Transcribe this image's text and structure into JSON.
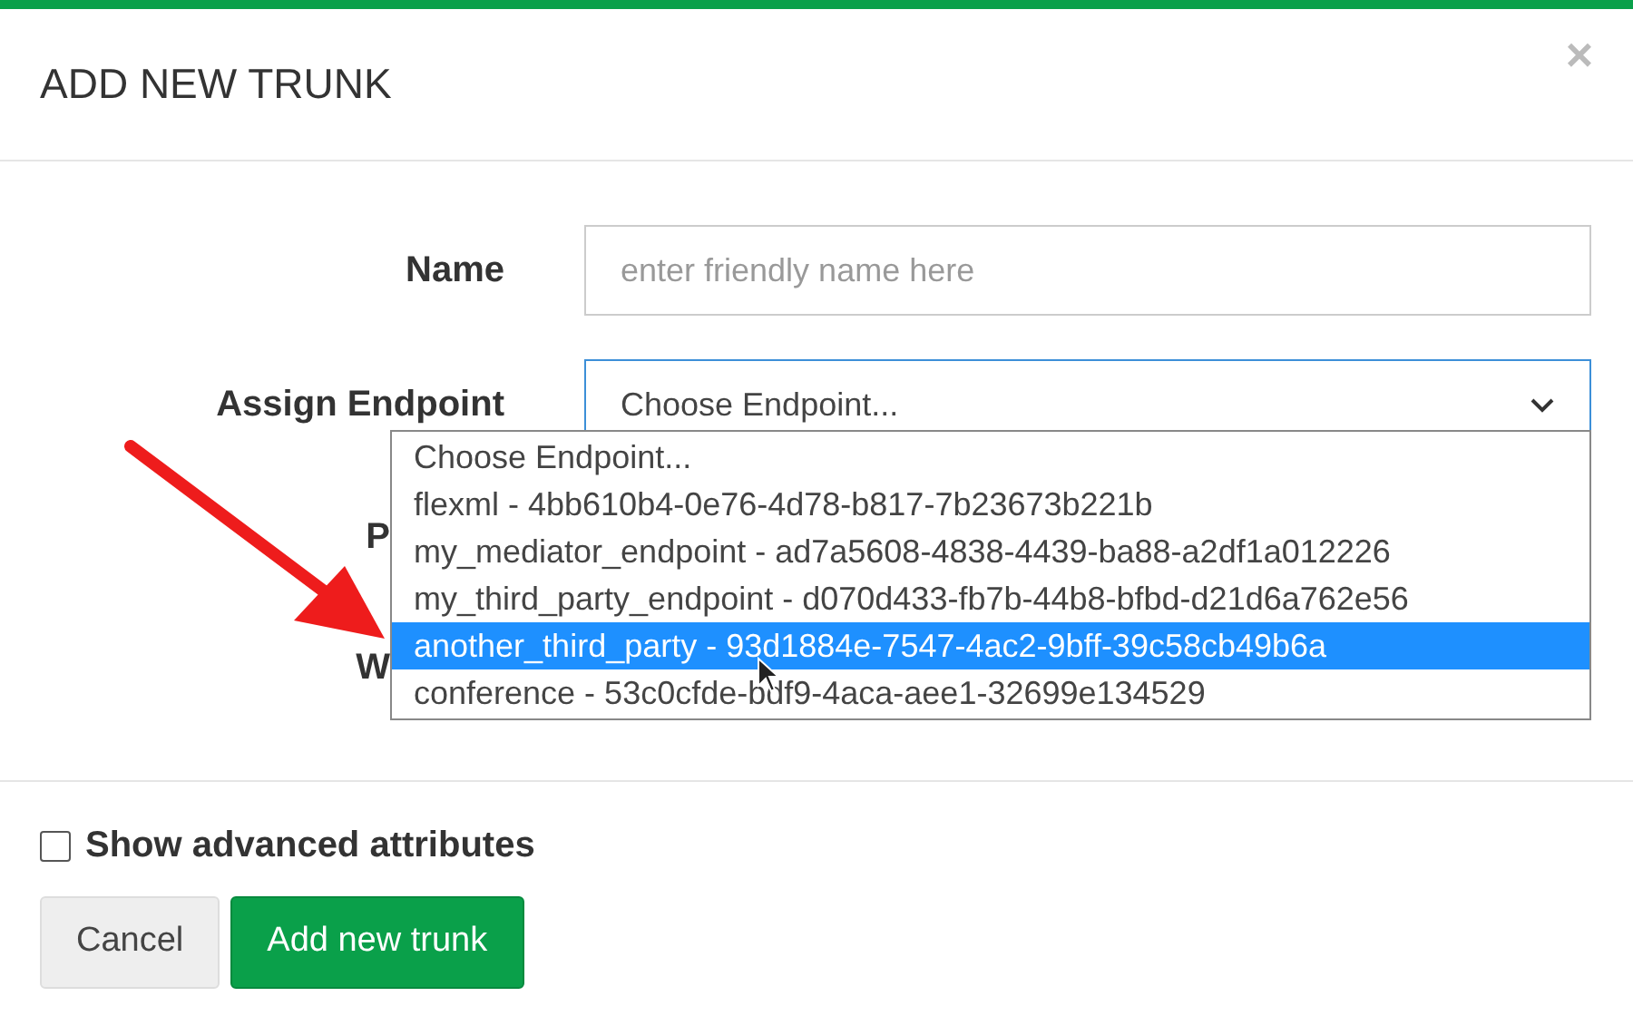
{
  "dialog": {
    "title": "ADD NEW TRUNK",
    "close": "×"
  },
  "fields": [
    {
      "kind": "text",
      "label": "Name",
      "placeholder": "enter friendly name here"
    },
    {
      "kind": "select",
      "label": "Assign Endpoint",
      "value": "Choose Endpoint...",
      "expanded": true,
      "options": [
        {
          "label": "Choose Endpoint...",
          "highlighted": false
        },
        {
          "label": "flexml - 4bb610b4-0e76-4d78-b817-7b23673b221b",
          "highlighted": false
        },
        {
          "label": "my_mediator_endpoint - ad7a5608-4838-4439-ba88-a2df1a012226",
          "highlighted": false
        },
        {
          "label": "my_third_party_endpoint - d070d433-fb7b-44b8-bfbd-d21d6a762e56",
          "highlighted": false
        },
        {
          "label": "another_third_party - 93d1884e-7547-4ac2-9bff-39c58cb49b6a",
          "highlighted": true
        },
        {
          "label": "conference - 53c0cfde-bdf9-4aca-aee1-32699e134529",
          "highlighted": false
        }
      ]
    },
    {
      "kind": "hidden",
      "label": "P"
    },
    {
      "kind": "hidden",
      "label": "W"
    }
  ],
  "advanced": {
    "label": "Show advanced attributes",
    "checked": false
  },
  "buttons": [
    {
      "label": "Cancel",
      "kind": "secondary"
    },
    {
      "label": "Add new trunk",
      "kind": "primary"
    }
  ]
}
